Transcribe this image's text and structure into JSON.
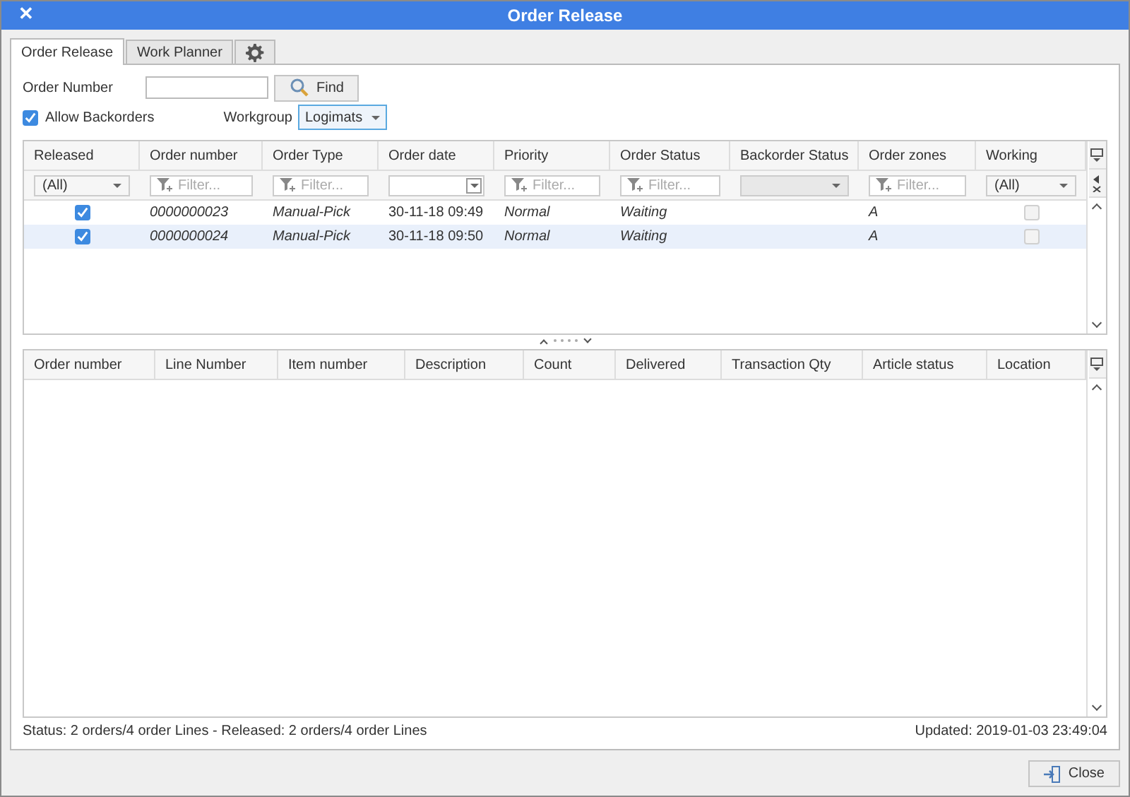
{
  "window": {
    "title": "Order Release",
    "close": "✕"
  },
  "tabs": [
    {
      "label": "Order Release",
      "selected": true
    },
    {
      "label": "Work Planner",
      "selected": false
    },
    {
      "kind": "settings",
      "selected": false
    }
  ],
  "order_number": {
    "label": "Order Number"
  },
  "find_button": "Find",
  "allow_backorders": {
    "label": "Allow Backorders",
    "checked": true
  },
  "workgroup": {
    "label": "Workgroup",
    "value": "Logimats"
  },
  "orders_table": {
    "columns": [
      "Released",
      "Order number",
      "Order Type",
      "Order date",
      "Priority",
      "Order Status",
      "Backorder Status",
      "Order zones",
      "Working"
    ],
    "filters": [
      {
        "kind": "select",
        "value": "(All)"
      },
      {
        "kind": "text",
        "placeholder": "Filter..."
      },
      {
        "kind": "text",
        "placeholder": "Filter..."
      },
      {
        "kind": "date"
      },
      {
        "kind": "text",
        "placeholder": "Filter..."
      },
      {
        "kind": "text",
        "placeholder": "Filter..."
      },
      {
        "kind": "select",
        "disabled": true
      },
      {
        "kind": "text",
        "placeholder": "Filter..."
      },
      {
        "kind": "select",
        "value": "(All)"
      }
    ],
    "rows": [
      {
        "selected": false,
        "released": true,
        "order_number": "0000000023",
        "order_type": "Manual-Pick",
        "order_date": "30-11-18 09:49",
        "priority": "Normal",
        "order_status": "Waiting",
        "order_zones": "A",
        "working": false
      },
      {
        "selected": true,
        "released": true,
        "order_number": "0000000024",
        "order_type": "Manual-Pick",
        "order_date": "30-11-18 09:50",
        "priority": "Normal",
        "order_status": "Waiting",
        "order_zones": "A",
        "working": false
      }
    ]
  },
  "lines_table": {
    "columns": [
      "Order number",
      "Line Number",
      "Item number",
      "Description",
      "Count",
      "Delivered",
      "Transaction Qty",
      "Article status",
      "Location"
    ]
  },
  "status_bar": {
    "status": "Status: 2 orders/4 order Lines - Released: 2 orders/4 order Lines",
    "updated": "Updated: 2019-01-03 23:49:04"
  },
  "close_button": "Close"
}
